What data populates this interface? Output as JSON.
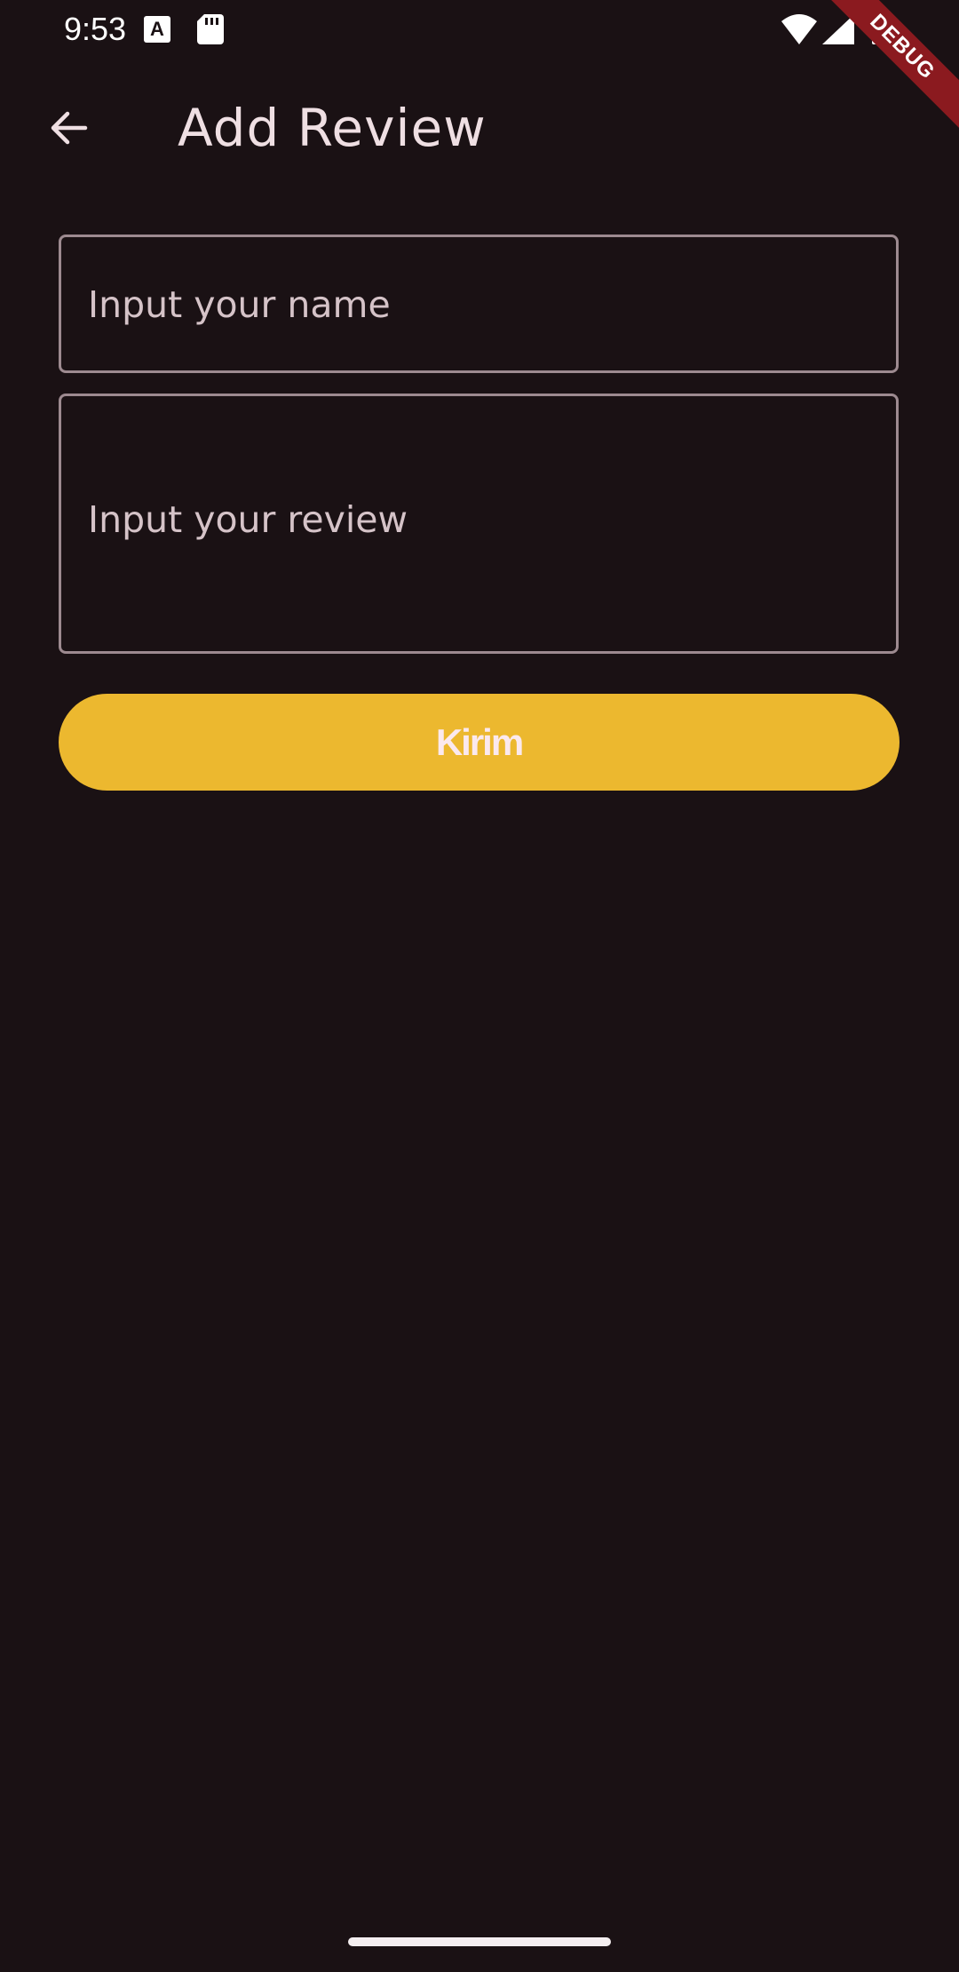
{
  "status_bar": {
    "time": "9:53",
    "a_icon_letter": "A",
    "icons": [
      "text-a-icon",
      "sd-card-icon",
      "wifi-icon",
      "signal-icon",
      "battery-icon"
    ]
  },
  "debug_banner": {
    "label": "DEBUG"
  },
  "app_bar": {
    "back_icon": "arrow-back-icon",
    "title": "Add Review"
  },
  "form": {
    "name_field": {
      "placeholder": "Input your name",
      "value": ""
    },
    "review_field": {
      "placeholder": "Input your review",
      "value": ""
    },
    "submit_label": "Kirim"
  },
  "colors": {
    "background": "#1a1114",
    "text": "#efdfe3",
    "field_border": "#9d8a90",
    "accent": "#ecb82f",
    "debug": "#8b1a1f"
  }
}
